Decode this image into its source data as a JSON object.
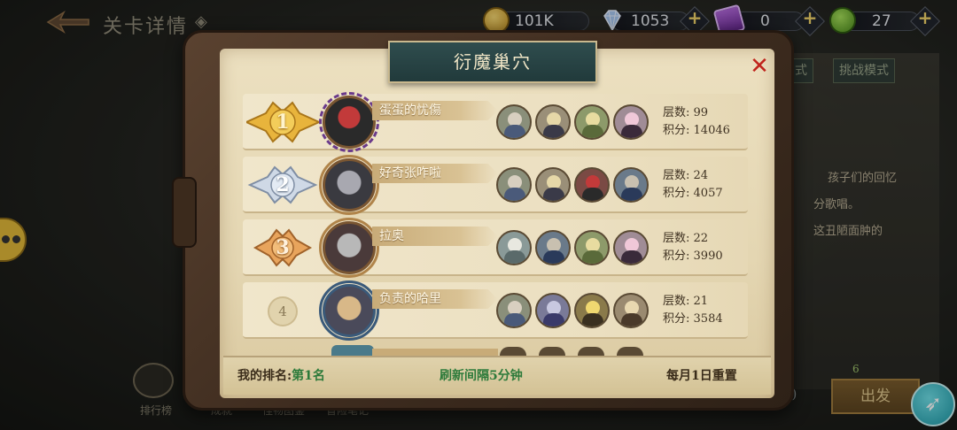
{
  "background": {
    "page_title": "关卡详情",
    "mode_tabs": [
      "式",
      "挑战模式"
    ],
    "story_lines": [
      "孩子们的回忆",
      "分歌唱。",
      "这丑陋面肿的"
    ],
    "go_button": "出发",
    "go_count": "6",
    "paren_text": "0)",
    "bottom_labels": [
      "排行榜",
      "成就",
      "怪物图鉴",
      "冒险笔记"
    ]
  },
  "currency": {
    "gold": "101K",
    "gems": "1053",
    "tickets": "0",
    "energy": "27"
  },
  "modal": {
    "title": "衍魔巢穴",
    "close_glyph": "✕",
    "rows": [
      {
        "rank": "1",
        "name": "蛋蛋的忧傷",
        "floors_label": "层数:",
        "floors": "99",
        "score_label": "积分:",
        "score": "14046",
        "team": [
          "hero-1",
          "hero-2",
          "hero-3",
          "hero-4"
        ]
      },
      {
        "rank": "2",
        "name": "好奇张咋啦",
        "floors_label": "层数:",
        "floors": "24",
        "score_label": "积分:",
        "score": "4057",
        "team": [
          "hero-1",
          "hero-2",
          "hero-5",
          "hero-6"
        ]
      },
      {
        "rank": "3",
        "name": "拉奥",
        "floors_label": "层数:",
        "floors": "22",
        "score_label": "积分:",
        "score": "3990",
        "team": [
          "hero-7",
          "hero-6",
          "hero-3",
          "hero-4"
        ]
      },
      {
        "rank": "4",
        "name": "负责的哈里",
        "floors_label": "层数:",
        "floors": "21",
        "score_label": "积分:",
        "score": "3584",
        "team": [
          "hero-1",
          "hero-2",
          "hero-8",
          "hero-9"
        ]
      }
    ],
    "footer": {
      "my_rank_label": "我的排名:",
      "my_rank_value": "第1名",
      "refresh_text": "刷新间隔5分钟",
      "reset_text": "每月1日重置"
    }
  },
  "colors": {
    "rank1": "#e8b43c",
    "rank2": "#cfd9e6",
    "rank3": "#e8a45c",
    "banner": "#2f4d4e",
    "close": "#c0241c"
  }
}
